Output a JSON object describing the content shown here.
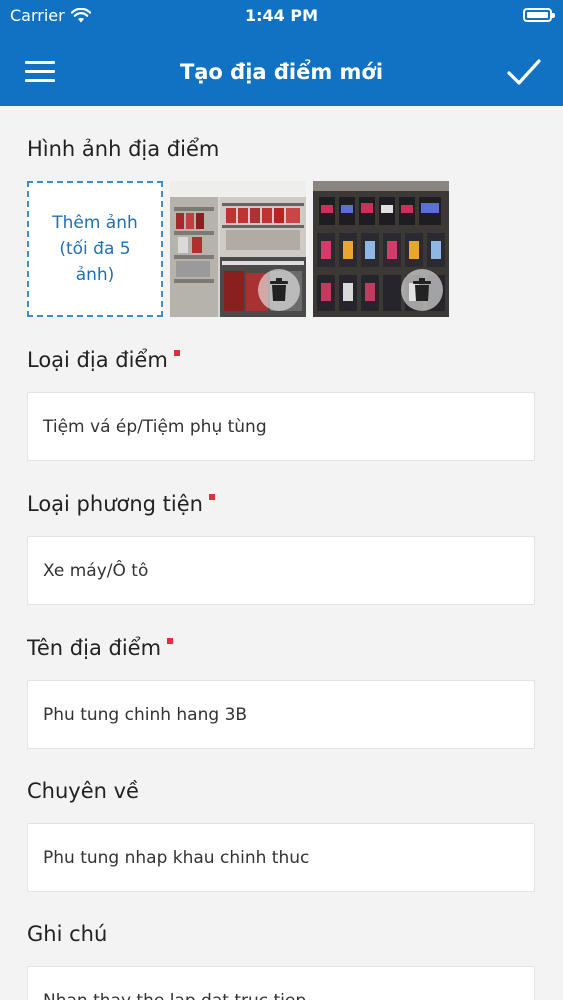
{
  "status_bar": {
    "carrier": "Carrier",
    "time": "1:44 PM"
  },
  "header": {
    "title": "Tạo địa điểm mới"
  },
  "photos": {
    "label": "Hình ảnh địa điểm",
    "add_label": "Thêm ảnh (tối đa 5 ảnh)"
  },
  "place_type": {
    "label": "Loại địa điểm",
    "value": "Tiệm vá ép/Tiệm phụ tùng",
    "required": true
  },
  "vehicle_type": {
    "label": "Loại phương tiện",
    "value": "Xe máy/Ô tô",
    "required": true
  },
  "place_name": {
    "label": "Tên địa điểm",
    "value": "Phu tung chinh hang 3B",
    "required": true
  },
  "specialty": {
    "label": "Chuyên về",
    "value": "Phu tung nhap khau chinh thuc"
  },
  "note": {
    "label": "Ghi chú",
    "value": "Nhan thay the lap dat truc tiep"
  },
  "colors": {
    "header": "#1172c4",
    "required_marker": "#e0303a",
    "background": "#f3f3f3"
  },
  "icons": {
    "menu": "hamburger-icon",
    "confirm": "checkmark-icon",
    "delete": "trash-icon",
    "wifi": "wifi-icon",
    "battery": "battery-icon"
  }
}
